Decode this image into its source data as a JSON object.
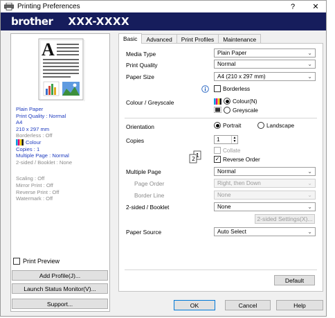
{
  "window": {
    "title": "Printing Preferences",
    "help_glyph": "?",
    "close_glyph": "✕"
  },
  "banner": {
    "brand": "brother",
    "model": "XXX-XXXX"
  },
  "summary": {
    "media": "Plain Paper",
    "quality": "Print Quality : Normal",
    "size": "A4",
    "dimensions": "210 x 297 mm",
    "borderless": "Borderless : Off",
    "colour": "Colour",
    "copies": "Copies : 1",
    "multiple_page": "Multiple Page : Normal",
    "two_sided": "2-sided / Booklet : None",
    "scaling": "Scaling : Off",
    "mirror": "Mirror Print : Off",
    "reverse": "Reverse Print : Off",
    "watermark": "Watermark : Off"
  },
  "left_buttons": {
    "print_preview": "Print Preview",
    "add_profile": "Add Profile(J)...",
    "status_monitor": "Launch Status Monitor(V)...",
    "support": "Support..."
  },
  "tabs": [
    "Basic",
    "Advanced",
    "Print Profiles",
    "Maintenance"
  ],
  "basic": {
    "media_type_label": "Media Type",
    "media_type_value": "Plain Paper",
    "print_quality_label": "Print Quality",
    "print_quality_value": "Normal",
    "paper_size_label": "Paper Size",
    "paper_size_value": "A4 (210 x 297 mm)",
    "borderless_label": "Borderless",
    "colour_label": "Colour / Greyscale",
    "colour_option": "Colour(N)",
    "greyscale_option": "Greyscale",
    "orientation_label": "Orientation",
    "portrait_option": "Portrait",
    "landscape_option": "Landscape",
    "copies_label": "Copies",
    "copies_value": "1",
    "collate_label": "Collate",
    "reverse_order_label": "Reverse Order",
    "multiple_page_label": "Multiple Page",
    "multiple_page_value": "Normal",
    "page_order_label": "Page Order",
    "page_order_value": "Right, then Down",
    "border_line_label": "Border Line",
    "border_line_value": "None",
    "two_sided_label": "2-sided / Booklet",
    "two_sided_value": "None",
    "two_sided_settings": "2-sided Settings(X)...",
    "paper_source_label": "Paper Source",
    "paper_source_value": "Auto Select",
    "default_button": "Default"
  },
  "dialog_buttons": {
    "ok": "OK",
    "cancel": "Cancel",
    "help": "Help"
  },
  "colors": {
    "banner": "#161d5c",
    "summary_text": "#1f3cbf",
    "disabled": "#9a9a9a"
  },
  "icons": [
    "printer-icon",
    "document-preview-icon",
    "info-icon",
    "colour-cartridge-icon",
    "greyscale-icon",
    "copies-order-icon",
    "chevron-down-icon"
  ]
}
